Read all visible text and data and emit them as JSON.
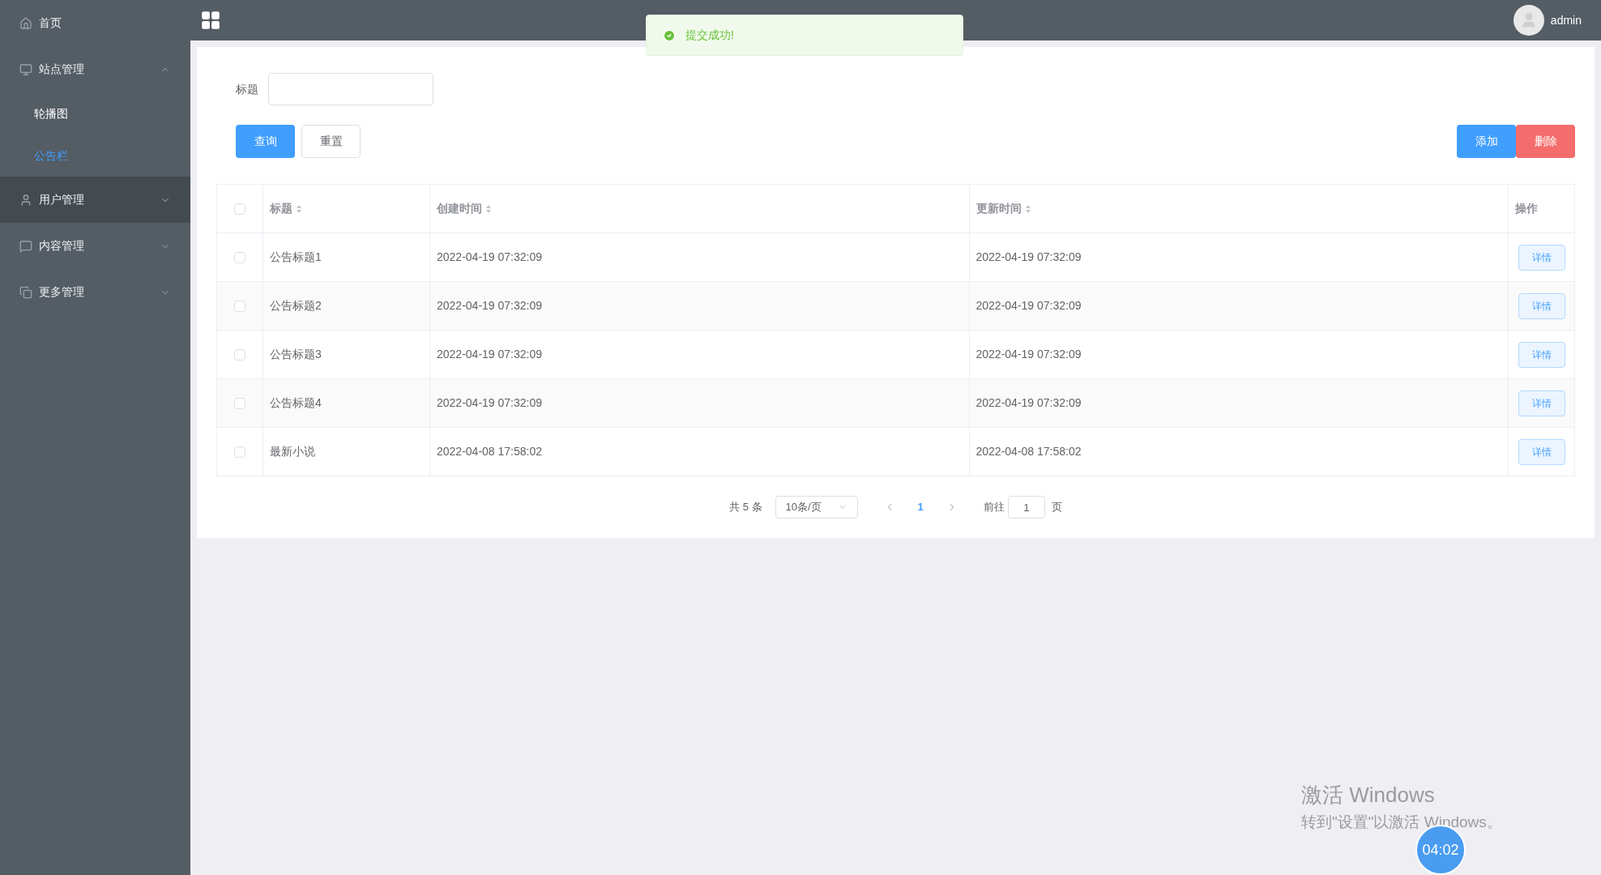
{
  "sidebar": {
    "items": [
      {
        "label": "首页",
        "hovered": false
      },
      {
        "label": "站点管理",
        "expanded": true,
        "hovered": false,
        "children": [
          {
            "label": "轮播图",
            "selected": false
          },
          {
            "label": "公告栏",
            "selected": true
          }
        ]
      },
      {
        "label": "用户管理",
        "expanded": false,
        "hovered": true
      },
      {
        "label": "内容管理",
        "expanded": false,
        "hovered": false
      },
      {
        "label": "更多管理",
        "expanded": false,
        "hovered": false
      }
    ]
  },
  "topbar": {
    "user": "admin"
  },
  "toast": {
    "text": "提交成功!"
  },
  "search": {
    "label": "标题"
  },
  "buttons": {
    "query": "查询",
    "reset": "重置",
    "add": "添加",
    "delete": "删除"
  },
  "table": {
    "all_checked": false,
    "columns": [
      {
        "label": "标题",
        "kind": "sortable"
      },
      {
        "label": "创建时间",
        "kind": "sortable"
      },
      {
        "label": "更新时间",
        "kind": "sortable"
      },
      {
        "label": "操作",
        "kind": "plain"
      }
    ],
    "rows": [
      {
        "checked": false,
        "cells": [
          "公告标题1",
          "2022-04-19 07:32:09",
          "2022-04-19 07:32:09"
        ],
        "action": "详情"
      },
      {
        "checked": false,
        "cells": [
          "公告标题2",
          "2022-04-19 07:32:09",
          "2022-04-19 07:32:09"
        ],
        "action": "详情"
      },
      {
        "checked": false,
        "cells": [
          "公告标题3",
          "2022-04-19 07:32:09",
          "2022-04-19 07:32:09"
        ],
        "action": "详情"
      },
      {
        "checked": false,
        "cells": [
          "公告标题4",
          "2022-04-19 07:32:09",
          "2022-04-19 07:32:09"
        ],
        "action": "详情"
      },
      {
        "checked": false,
        "cells": [
          "最新小说",
          "2022-04-08 17:58:02",
          "2022-04-08 17:58:02"
        ],
        "action": "详情"
      }
    ]
  },
  "pagination": {
    "total": "共 5 条",
    "page_size": "10条/页",
    "pages": [
      {
        "label": "1",
        "selected": true
      }
    ],
    "goto_label": "前往",
    "goto_value": "1",
    "goto_suffix": "页"
  },
  "windows_notice": {
    "title": "激活 Windows",
    "text": "转到\"设置\"以激活 Windows。"
  },
  "timer": "04:02"
}
